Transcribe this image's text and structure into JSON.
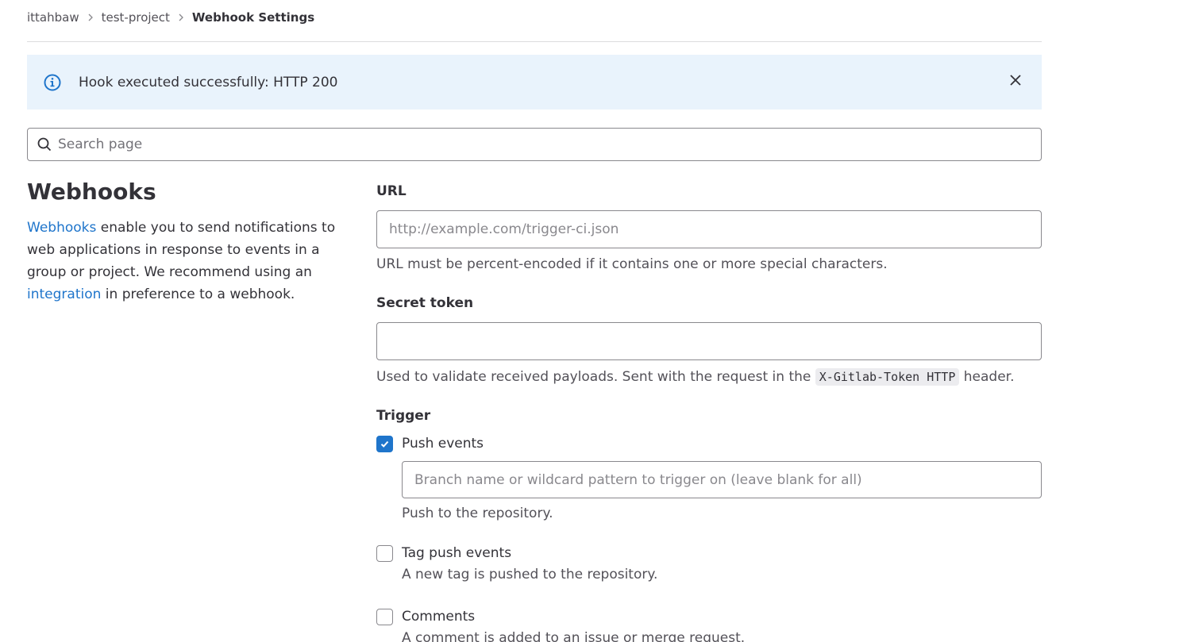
{
  "breadcrumb": {
    "items": [
      "ittahbaw",
      "test-project"
    ],
    "current": "Webhook Settings"
  },
  "alert": {
    "message": "Hook executed successfully: HTTP 200",
    "icon": "info-icon",
    "close_icon": "close-icon",
    "background": "#e9f3fc"
  },
  "search": {
    "placeholder": "Search page",
    "value": ""
  },
  "section": {
    "title": "Webhooks",
    "desc_link1": "Webhooks",
    "desc_part1": " enable you to send notifications to web applications in response to events in a group or project. We recommend using an ",
    "desc_link2": "integration",
    "desc_part2": " in preference to a webhook."
  },
  "url_field": {
    "label": "URL",
    "placeholder": "http://example.com/trigger-ci.json",
    "value": "",
    "help": "URL must be percent-encoded if it contains one or more special characters."
  },
  "token_field": {
    "label": "Secret token",
    "value": "",
    "help_before": "Used to validate received payloads. Sent with the request in the ",
    "help_code": "X-Gitlab-Token HTTP",
    "help_after": " header."
  },
  "trigger": {
    "label": "Trigger",
    "push": {
      "label": "Push events",
      "checked": true,
      "branch_placeholder": "Branch name or wildcard pattern to trigger on (leave blank for all)",
      "help": "Push to the repository."
    },
    "tag_push": {
      "label": "Tag push events",
      "checked": false,
      "help": "A new tag is pushed to the repository."
    },
    "comments": {
      "label": "Comments",
      "checked": false,
      "help": "A comment is added to an issue or merge request."
    }
  },
  "colors": {
    "accent": "#1f75cb",
    "link": "#1f75cb",
    "text": "#333238",
    "muted": "#535158"
  }
}
